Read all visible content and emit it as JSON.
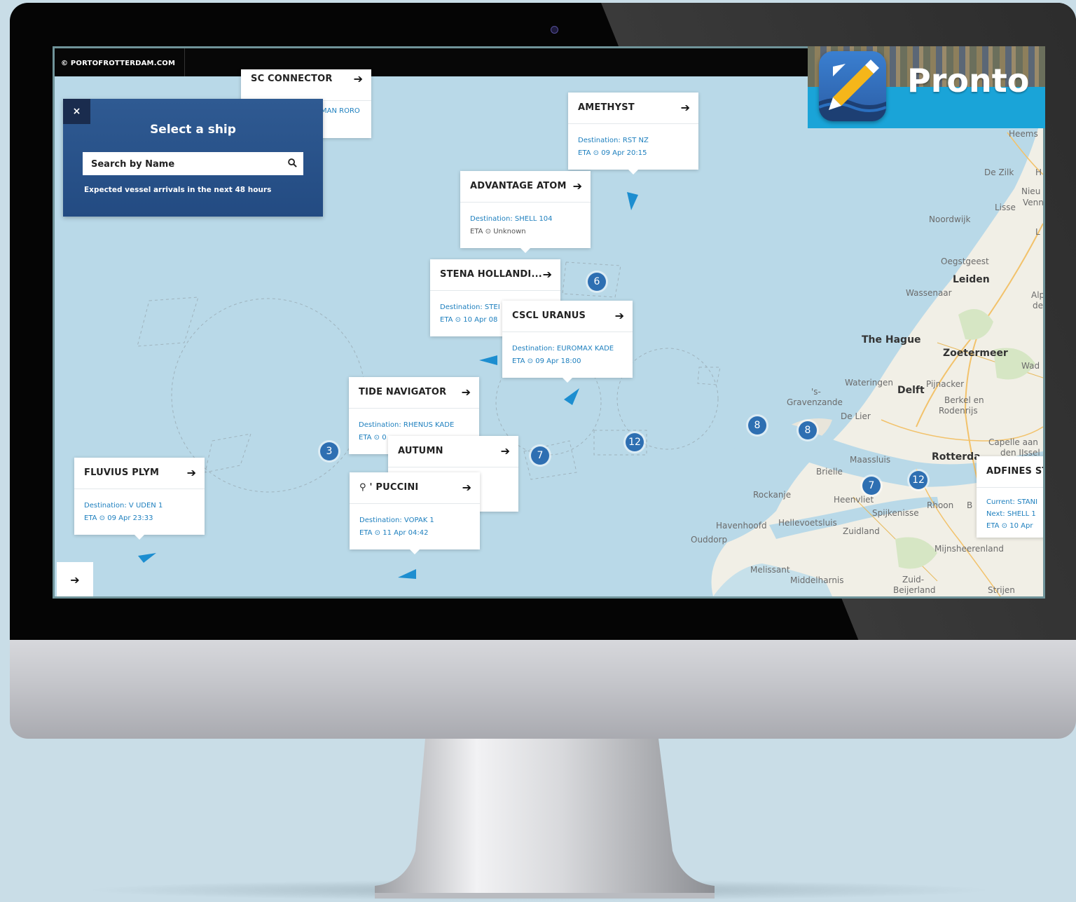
{
  "site": {
    "label": "© PORTOFROTTERDAM.COM"
  },
  "search_panel": {
    "title": "Select a ship",
    "close_symbol": "×",
    "placeholder": "Search by Name",
    "note": "Expected vessel arrivals in the next 48 hours"
  },
  "brand": {
    "name": "Pronto",
    "accent": "#1aa4d8"
  },
  "arrow_symbol": "➔",
  "ships": [
    {
      "name": "SC CONNECTOR",
      "line1": "MAN RORO"
    },
    {
      "name": "AMETHYST",
      "line1": "Destination: RST NZ",
      "line2": "ETA ⊙ 09 Apr 20:15"
    },
    {
      "name": "ADVANTAGE ATOM",
      "line1": "Destination: SHELL 104",
      "line2": "ETA ⊙ Unknown"
    },
    {
      "name": "STENA HOLLANDI...",
      "line1": "Destination: STEI",
      "line2": "ETA ⊙ 10 Apr 08"
    },
    {
      "name": "CSCL URANUS",
      "line1": "Destination: EUROMAX KADE",
      "line2": "ETA ⊙ 09 Apr 18:00"
    },
    {
      "name": "TIDE NAVIGATOR",
      "line1": "Destination: RHENUS KADE",
      "line2": "ETA ⊙ 0"
    },
    {
      "name": "AUTUMN"
    },
    {
      "name": "⚲ ' PUCCINI",
      "line1": "Destination: VOPAK 1",
      "line2": "ETA ⊙ 11 Apr 04:42"
    },
    {
      "name": "FLUVIUS PLYM",
      "line1": "Destination: V UDEN 1",
      "line2": "ETA ⊙ 09 Apr 23:33"
    },
    {
      "name": "ADFINES ST",
      "line1": "Current: STANI",
      "line2": "Next: SHELL 1",
      "line3": "ETA ⊙ 10 Apr"
    }
  ],
  "clusters": [
    "6",
    "3",
    "7",
    "12",
    "8",
    "8",
    "7",
    "12"
  ],
  "places": [
    "Heems",
    "De Zilk",
    "H",
    "Nieu",
    "Venn",
    "Lisse",
    "Noordwijk",
    "L",
    "Oegstgeest",
    "Leiden",
    "Wassenaar",
    "Alp",
    "de",
    "The Hague",
    "Zoetermeer",
    "Wad",
    "Wateringen",
    "Delft",
    "Pijnacker",
    "Berkel en",
    "Rodenrijs",
    "'s-",
    "Gravenzande",
    "De Lier",
    "Maassluis",
    "Rotterda",
    "Capelle aan",
    "den IJssel",
    "Brielle",
    "Rockanje",
    "Heenvliet",
    "Rhoon",
    "B",
    "Spijkenisse",
    "Havenhoofd",
    "Hellevoetsluis",
    "Zuidland",
    "Ouddorp",
    "Mijnsheerenland",
    "Melissant",
    "Middelharnis",
    "Zuid-",
    "Beijerland",
    "Strijen"
  ]
}
